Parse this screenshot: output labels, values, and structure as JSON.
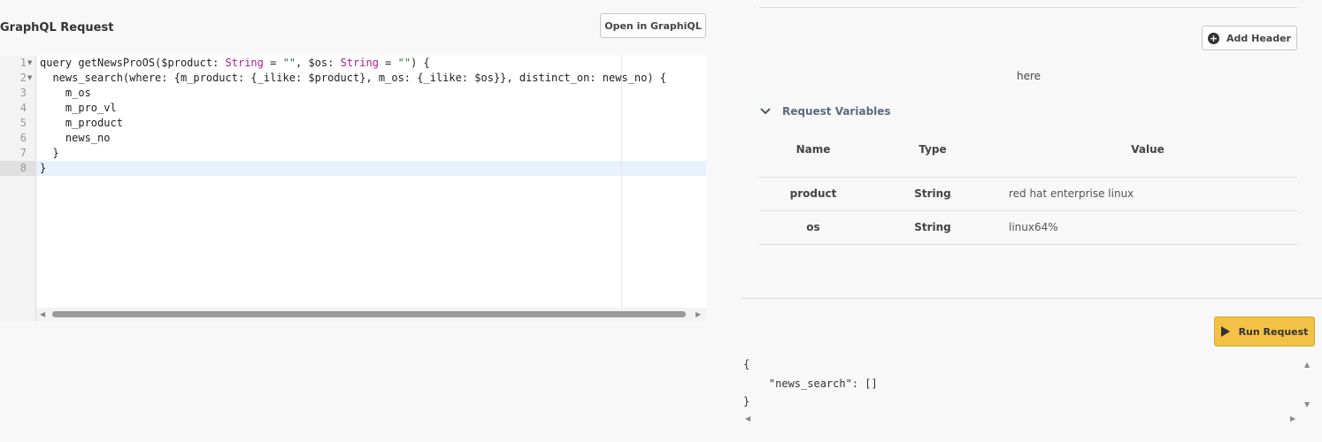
{
  "request": {
    "title": "GraphQL Request",
    "open_button": "Open in GraphiQL"
  },
  "editor": {
    "line_numbers": [
      "1",
      "2",
      "3",
      "4",
      "5",
      "6",
      "7",
      "8"
    ],
    "lines": [
      [
        {
          "t": "query getNewsProOS($product: ",
          "c": "kw"
        },
        {
          "t": "String",
          "c": "type"
        },
        {
          "t": " = ",
          "c": "kw"
        },
        {
          "t": "\"\"",
          "c": "str"
        },
        {
          "t": ", $os: ",
          "c": "kw"
        },
        {
          "t": "String",
          "c": "type"
        },
        {
          "t": " = ",
          "c": "kw"
        },
        {
          "t": "\"\"",
          "c": "str"
        },
        {
          "t": ") {",
          "c": "kw"
        }
      ],
      [
        {
          "t": "  news_search(where: {m_product: {_ilike: $product}, m_os: {_ilike: $os}}, distinct_on: news_no) {",
          "c": "kw"
        }
      ],
      [
        {
          "t": "    m_os",
          "c": "kw"
        }
      ],
      [
        {
          "t": "    m_pro_vl",
          "c": "kw"
        }
      ],
      [
        {
          "t": "    m_product",
          "c": "kw"
        }
      ],
      [
        {
          "t": "    news_no",
          "c": "kw"
        }
      ],
      [
        {
          "t": "  }",
          "c": "kw"
        }
      ],
      [
        {
          "t": "}",
          "c": "kw"
        }
      ]
    ]
  },
  "headers": {
    "add_button": "Add Header",
    "placeholder_text": "here"
  },
  "variables": {
    "section_label": "Request Variables",
    "columns": [
      "Name",
      "Type",
      "Value"
    ],
    "rows": [
      {
        "name": "product",
        "type": "String",
        "value": "red hat enterprise linux"
      },
      {
        "name": "os",
        "type": "String",
        "value": "linux64%"
      }
    ]
  },
  "run": {
    "button_label": "Run Request"
  },
  "response": {
    "lines": [
      "{",
      "    \"news_search\": []",
      "}"
    ]
  }
}
